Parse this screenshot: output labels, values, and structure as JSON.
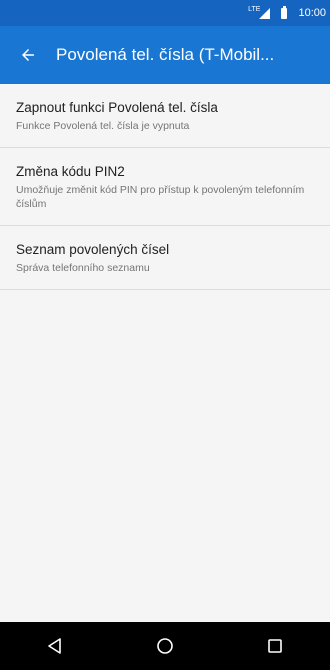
{
  "status_bar": {
    "network": "LTE",
    "time": "10:00",
    "icons": [
      "signal-icon",
      "battery-icon"
    ]
  },
  "app_bar": {
    "back_icon": "arrow-left-icon",
    "title": "Povolená tel. čísla (T-Mobil..."
  },
  "items": [
    {
      "title": "Zapnout funkci Povolená tel. čísla",
      "subtitle": "Funkce Povolená tel. čísla je vypnuta"
    },
    {
      "title": "Změna kódu PIN2",
      "subtitle": "Umožňuje změnit kód PIN pro přístup k povoleným telefonním číslům"
    },
    {
      "title": "Seznam povolených čísel",
      "subtitle": "Správa telefonního seznamu"
    }
  ],
  "nav_bar": {
    "icons": [
      "back-triangle-icon",
      "home-circle-icon",
      "recents-square-icon"
    ]
  },
  "colors": {
    "status_bar": "#1565c0",
    "app_bar": "#1976d2",
    "background": "#f5f5f5",
    "nav_bar": "#000000"
  }
}
